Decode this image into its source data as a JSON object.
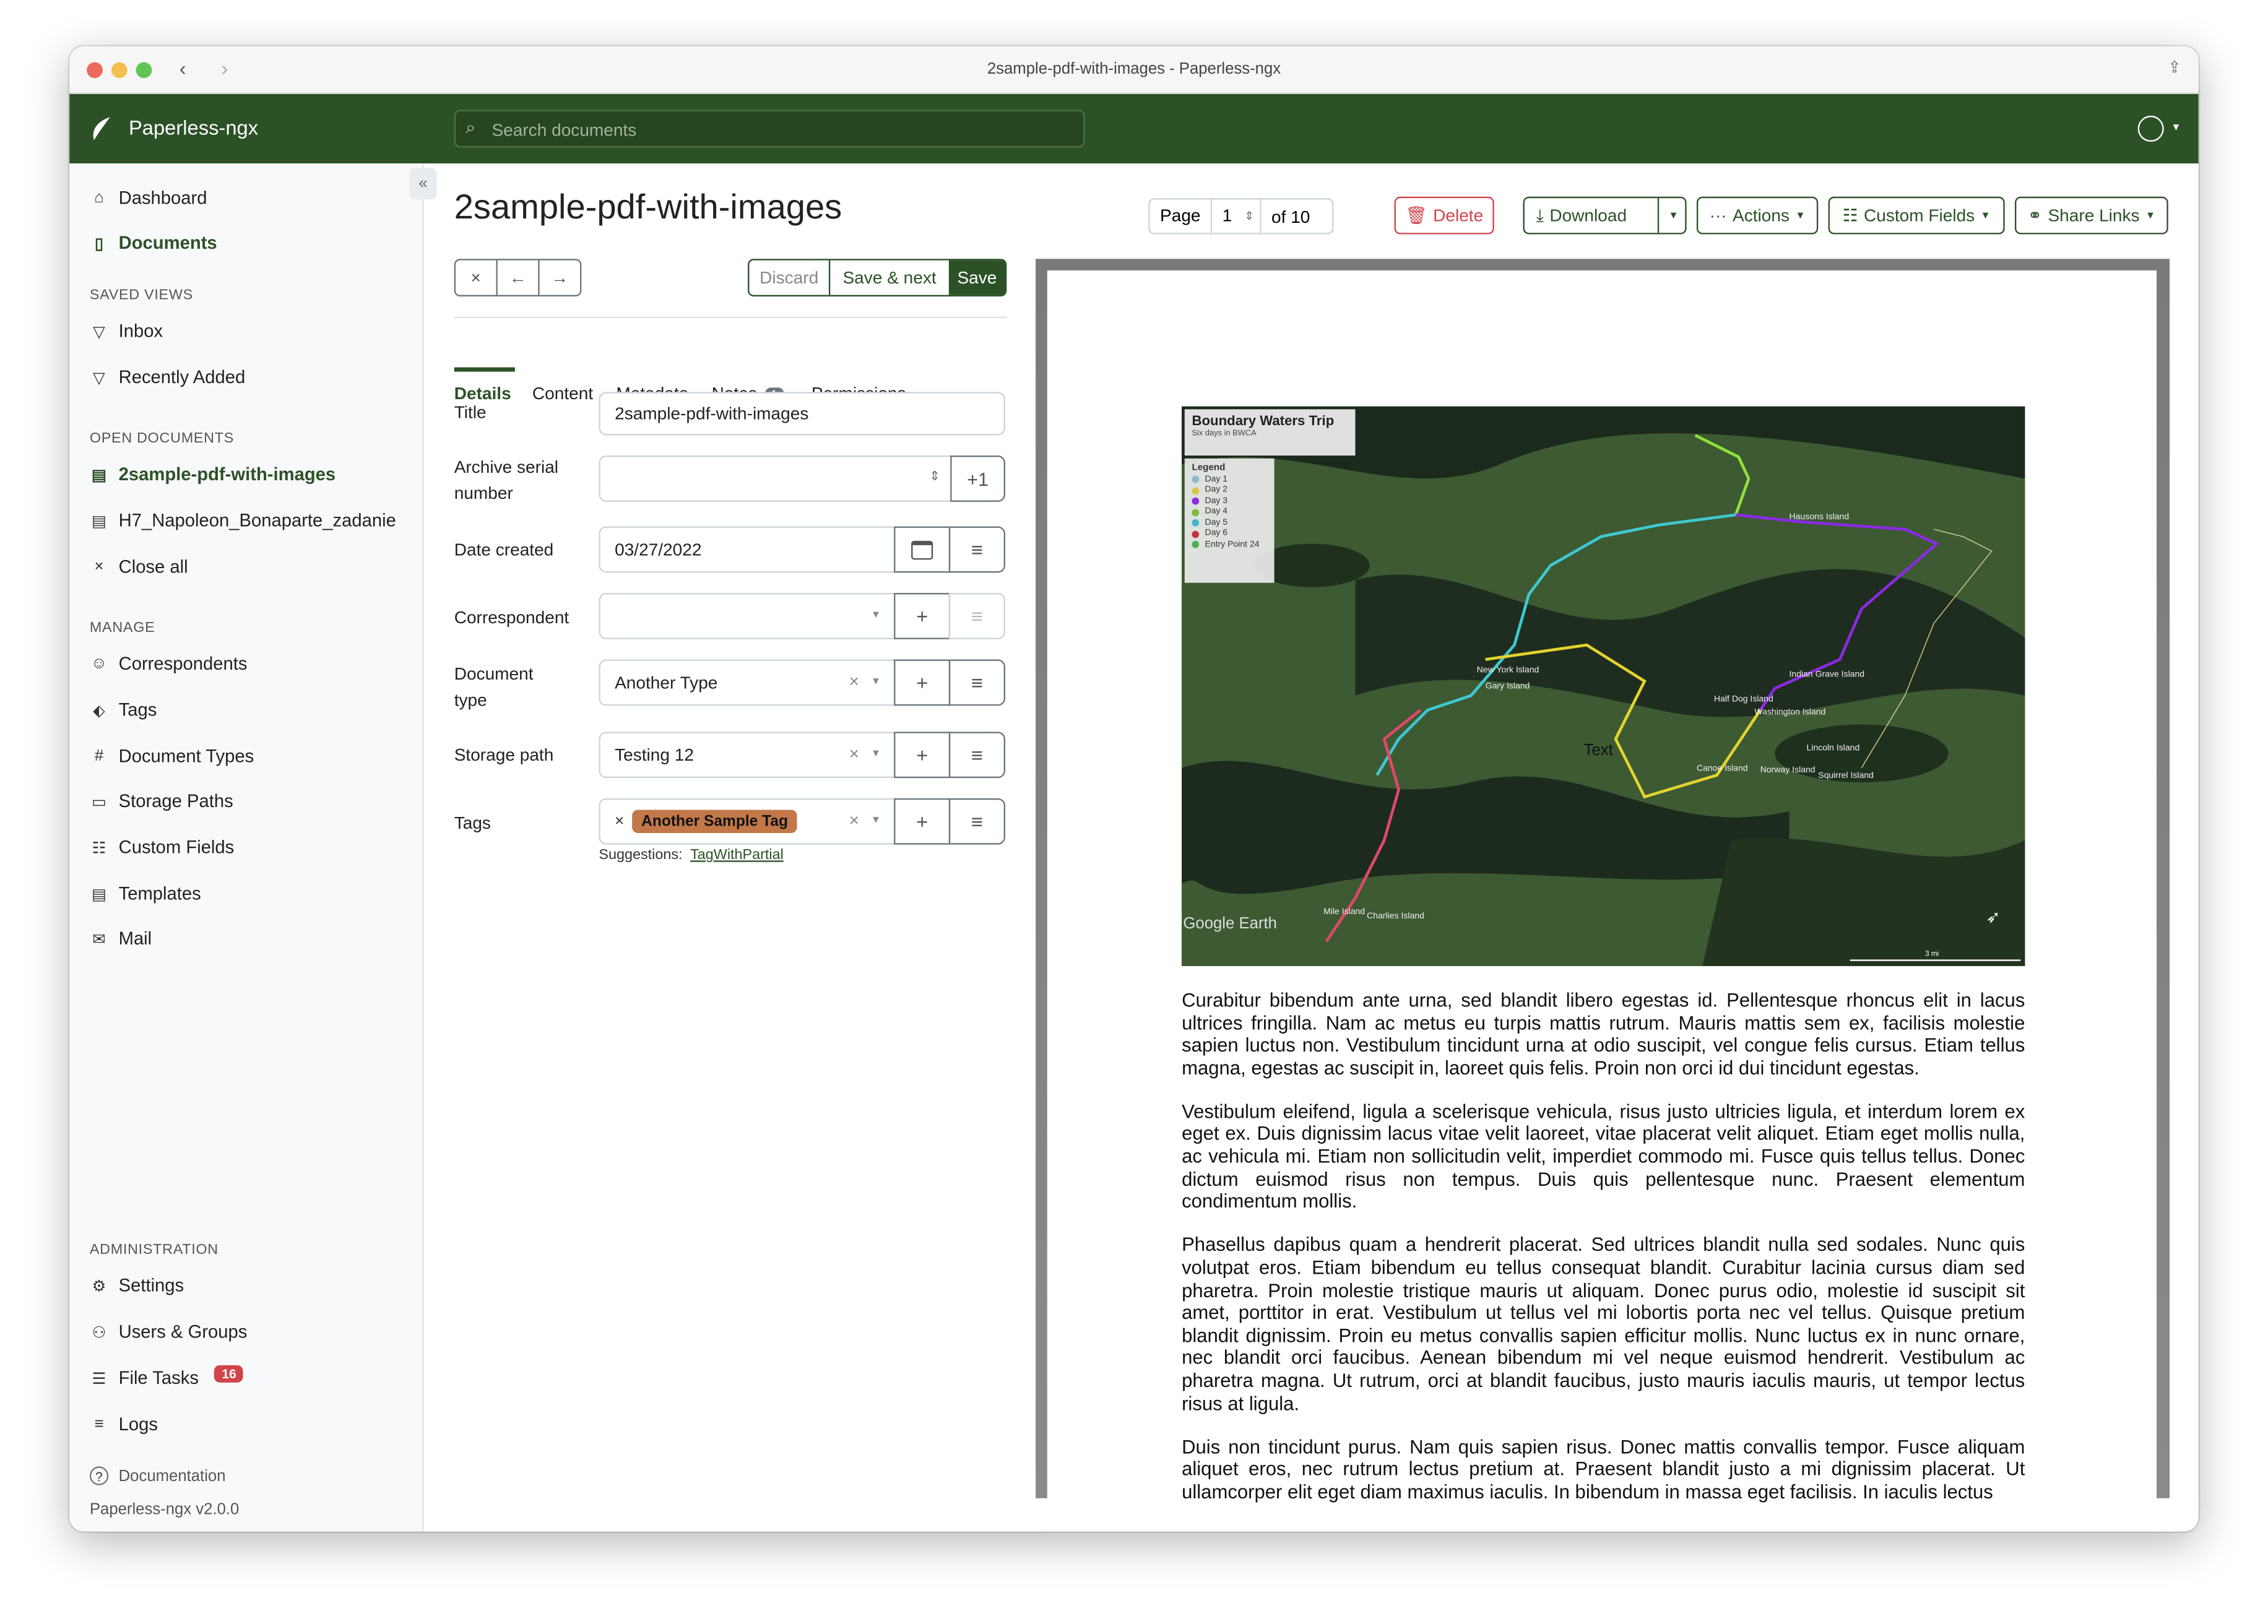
{
  "window": {
    "title": "2sample-pdf-with-images - Paperless-ngx"
  },
  "header": {
    "brand": "Paperless-ngx",
    "search_placeholder": "Search documents"
  },
  "sidebar": {
    "main": [
      {
        "label": "Dashboard",
        "icon": "house-icon"
      },
      {
        "label": "Documents",
        "icon": "documents-icon",
        "active": true
      }
    ],
    "saved_views_heading": "SAVED VIEWS",
    "saved_views": [
      {
        "label": "Inbox"
      },
      {
        "label": "Recently Added"
      }
    ],
    "open_documents_heading": "OPEN DOCUMENTS",
    "open_documents": [
      {
        "label": "2sample-pdf-with-images",
        "active": true
      },
      {
        "label": "H7_Napoleon_Bonaparte_zadanie"
      }
    ],
    "close_all": "Close all",
    "manage_heading": "MANAGE",
    "manage": [
      {
        "label": "Correspondents"
      },
      {
        "label": "Tags"
      },
      {
        "label": "Document Types"
      },
      {
        "label": "Storage Paths"
      },
      {
        "label": "Custom Fields"
      },
      {
        "label": "Templates"
      },
      {
        "label": "Mail"
      }
    ],
    "admin_heading": "ADMINISTRATION",
    "admin": [
      {
        "label": "Settings"
      },
      {
        "label": "Users & Groups"
      },
      {
        "label": "File Tasks",
        "badge": "16"
      },
      {
        "label": "Logs"
      }
    ],
    "documentation": "Documentation",
    "version": "Paperless-ngx v2.0.0"
  },
  "document": {
    "title": "2sample-pdf-with-images"
  },
  "toolbar": {
    "page_label": "Page",
    "page_value": "1",
    "page_of": "of 10",
    "delete": "Delete",
    "download": "Download",
    "actions": "Actions",
    "custom_fields": "Custom Fields",
    "share_links": "Share Links",
    "discard": "Discard",
    "save_next": "Save & next",
    "save": "Save"
  },
  "tabs": [
    {
      "label": "Details",
      "active": true
    },
    {
      "label": "Content"
    },
    {
      "label": "Metadata"
    },
    {
      "label": "Notes",
      "badge": "1"
    },
    {
      "label": "Permissions"
    }
  ],
  "form": {
    "title_label": "Title",
    "title_value": "2sample-pdf-with-images",
    "asn_label": "Archive serial number",
    "asn_value": "",
    "asn_plus": "+1",
    "date_label": "Date created",
    "date_value": "03/27/2022",
    "correspondent_label": "Correspondent",
    "correspondent_value": "",
    "doctype_label": "Document type",
    "doctype_value": "Another Type",
    "storage_label": "Storage path",
    "storage_value": "Testing 12",
    "tags_label": "Tags",
    "tag": "Another Sample Tag",
    "tag_color": "#c3784a",
    "suggestions_label": "Suggestions:",
    "suggestion": "TagWithPartial"
  },
  "colors": {
    "primary": "#2c5127",
    "danger": "#d1444a"
  },
  "map": {
    "title": "Boundary Waters Trip",
    "subtitle": "Six days in BWCA",
    "legend_title": "Legend",
    "legend": [
      "Day 1",
      "Day 2",
      "Day 3",
      "Day 4",
      "Day 5",
      "Day 6",
      "Entry Point 24"
    ],
    "places": [
      "Hausons Island",
      "New York Island",
      "Gary Island",
      "Indian Grave Island",
      "Half Dog Island",
      "Washington Island",
      "Lincoln Island",
      "Canoe Island",
      "Norway Island",
      "Squirrel Island",
      "Mile Island",
      "Charlies Island"
    ],
    "overlay_text": "Text",
    "watermark": "Google Earth",
    "scale": "3 mi"
  },
  "pdf_paragraphs": [
    "Curabitur bibendum ante urna, sed blandit libero egestas id. Pellentesque rhoncus elit in lacus ultrices fringilla. Nam ac metus eu turpis mattis rutrum. Mauris mattis sem ex, facilisis molestie sapien luctus non. Vestibulum tincidunt urna at odio suscipit, vel congue felis cursus. Etiam tellus magna, egestas ac suscipit in, laoreet quis felis. Proin non orci id dui tincidunt egestas.",
    "Vestibulum eleifend, ligula a scelerisque vehicula, risus justo ultricies ligula, et interdum lorem ex eget ex. Duis dignissim lacus vitae velit laoreet, vitae placerat velit aliquet. Etiam eget mollis nulla, ac vehicula mi. Etiam non sollicitudin velit, imperdiet commodo mi. Fusce quis tellus tellus. Donec dictum euismod risus non tempus. Duis quis pellentesque nunc. Praesent elementum condimentum mollis.",
    "Phasellus dapibus quam a hendrerit placerat. Sed ultrices blandit nulla sed sodales. Nunc quis volutpat eros. Etiam bibendum eu tellus consequat blandit. Curabitur lacinia cursus diam sed pharetra. Proin molestie tristique mauris ut aliquam. Donec purus odio, molestie id suscipit sit amet, porttitor in erat. Vestibulum ut tellus vel mi lobortis porta nec vel tellus. Quisque pretium blandit dignissim. Proin eu metus convallis sapien efficitur mollis. Nunc luctus ex in nunc ornare, nec blandit orci faucibus. Aenean bibendum mi vel neque euismod hendrerit. Vestibulum ac pharetra magna. Ut rutrum, orci at blandit faucibus, justo mauris iaculis mauris, ut tempor lectus risus at ligula.",
    "Duis non tincidunt purus. Nam quis sapien risus. Donec mattis convallis tempor. Fusce aliquam aliquet eros, nec rutrum lectus pretium at. Praesent blandit justo a mi dignissim placerat. Ut ullamcorper elit eget diam maximus iaculis. In bibendum in massa eget facilisis. In iaculis lectus"
  ]
}
